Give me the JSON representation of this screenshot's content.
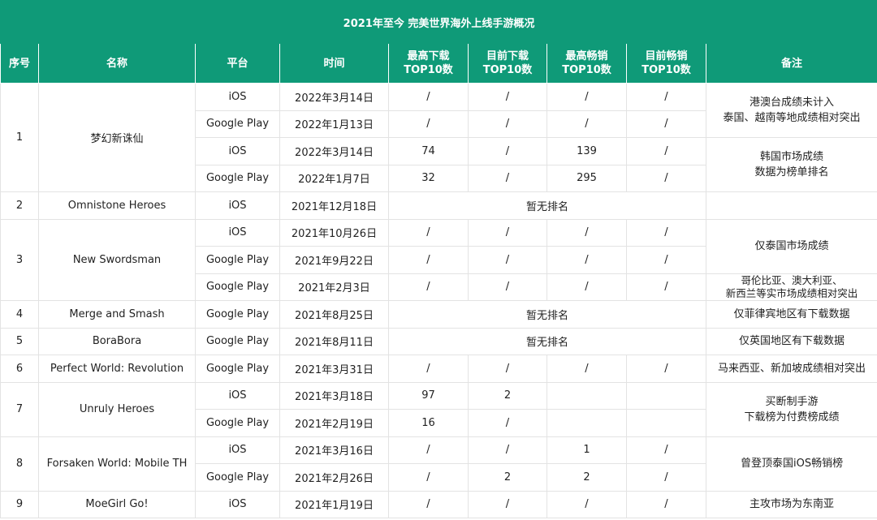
{
  "title": "2021年至今 完美世界海外上线手游概况",
  "headers": {
    "idx": "序号",
    "name": "名称",
    "platform": "平台",
    "date": "时间",
    "max_dl_1": "最高下载",
    "max_dl_2": "TOP10数",
    "cur_dl_1": "目前下载",
    "cur_dl_2": "TOP10数",
    "max_gr_1": "最高畅销",
    "max_gr_2": "TOP10数",
    "cur_gr_1": "目前畅销",
    "cur_gr_2": "TOP10数",
    "note": "备注"
  },
  "games": [
    {
      "idx": "1",
      "name": "梦幻新诛仙",
      "rows": [
        {
          "platform": "iOS",
          "date": "2022年3月14日",
          "max_dl": "/",
          "cur_dl": "/",
          "max_gr": "/",
          "cur_gr": "/"
        },
        {
          "platform": "Google Play",
          "date": "2022年1月13日",
          "max_dl": "/",
          "cur_dl": "/",
          "max_gr": "/",
          "cur_gr": "/"
        },
        {
          "platform": "iOS",
          "date": "2022年3月14日",
          "max_dl": "74",
          "cur_dl": "/",
          "max_gr": "139",
          "cur_gr": "/"
        },
        {
          "platform": "Google Play",
          "date": "2022年1月7日",
          "max_dl": "32",
          "cur_dl": "/",
          "max_gr": "295",
          "cur_gr": "/"
        }
      ],
      "notes": [
        {
          "lines": [
            "港澳台成绩未计入",
            "泰国、越南等地成绩相对突出"
          ]
        },
        {
          "lines": [
            "韩国市场成绩",
            "数据为榜单排名"
          ]
        }
      ]
    },
    {
      "idx": "2",
      "name": "Omnistone Heroes",
      "rows": [
        {
          "platform": "iOS",
          "date": "2021年12月18日",
          "merged": "暂无排名"
        }
      ],
      "notes": [
        {
          "lines": [
            "",
            ""
          ]
        }
      ]
    },
    {
      "idx": "3",
      "name": "New Swordsman",
      "rows": [
        {
          "platform": "iOS",
          "date": "2021年10月26日",
          "max_dl": "/",
          "cur_dl": "/",
          "max_gr": "/",
          "cur_gr": "/"
        },
        {
          "platform": "Google Play",
          "date": "2021年9月22日",
          "max_dl": "/",
          "cur_dl": "/",
          "max_gr": "/",
          "cur_gr": "/"
        },
        {
          "platform": "Google Play",
          "date": "2021年2月3日",
          "max_dl": "/",
          "cur_dl": "/",
          "max_gr": "/",
          "cur_gr": "/"
        }
      ],
      "notes": [
        {
          "lines": [
            "仅泰国市场成绩",
            ""
          ]
        },
        {
          "lines": [
            "哥伦比亚、澳大利亚、",
            "新西兰等实市场成绩相对突出"
          ]
        }
      ]
    },
    {
      "idx": "4",
      "name": "Merge and Smash",
      "rows": [
        {
          "platform": "Google Play",
          "date": "2021年8月25日",
          "merged": "暂无排名"
        }
      ],
      "notes": [
        {
          "lines": [
            "仅菲律宾地区有下载数据",
            ""
          ]
        }
      ]
    },
    {
      "idx": "5",
      "name": "BoraBora",
      "rows": [
        {
          "platform": "Google Play",
          "date": "2021年8月11日",
          "merged": "暂无排名"
        }
      ],
      "notes": [
        {
          "lines": [
            "仅英国地区有下载数据",
            ""
          ]
        }
      ]
    },
    {
      "idx": "6",
      "name": "Perfect World: Revolution",
      "rows": [
        {
          "platform": "Google Play",
          "date": "2021年3月31日",
          "max_dl": "/",
          "cur_dl": "/",
          "max_gr": "/",
          "cur_gr": "/"
        }
      ],
      "notes": [
        {
          "lines": [
            "马来西亚、新加坡成绩相对突出",
            ""
          ]
        }
      ]
    },
    {
      "idx": "7",
      "name": "Unruly Heroes",
      "rows": [
        {
          "platform": "iOS",
          "date": "2021年3月18日",
          "max_dl": "97",
          "cur_dl": "2",
          "max_gr": "",
          "cur_gr": ""
        },
        {
          "platform": "Google Play",
          "date": "2021年2月19日",
          "max_dl": "16",
          "cur_dl": "/",
          "max_gr": "",
          "cur_gr": ""
        }
      ],
      "notes": [
        {
          "lines": [
            "买断制手游",
            "下载榜为付费榜成绩"
          ]
        }
      ]
    },
    {
      "idx": "8",
      "name": "Forsaken World: Mobile TH",
      "rows": [
        {
          "platform": "iOS",
          "date": "2021年3月16日",
          "max_dl": "/",
          "cur_dl": "/",
          "max_gr": "1",
          "cur_gr": "/"
        },
        {
          "platform": "Google Play",
          "date": "2021年2月26日",
          "max_dl": "/",
          "cur_dl": "2",
          "max_gr": "2",
          "cur_gr": "/"
        }
      ],
      "notes": [
        {
          "lines": [
            "曾登顶泰国iOS畅销榜",
            ""
          ]
        }
      ]
    },
    {
      "idx": "9",
      "name": "MoeGirl Go!",
      "rows": [
        {
          "platform": "iOS",
          "date": "2021年1月19日",
          "max_dl": "/",
          "cur_dl": "/",
          "max_gr": "/",
          "cur_gr": "/"
        }
      ],
      "notes": [
        {
          "lines": [
            "主攻市场为东南亚",
            ""
          ]
        }
      ]
    }
  ]
}
